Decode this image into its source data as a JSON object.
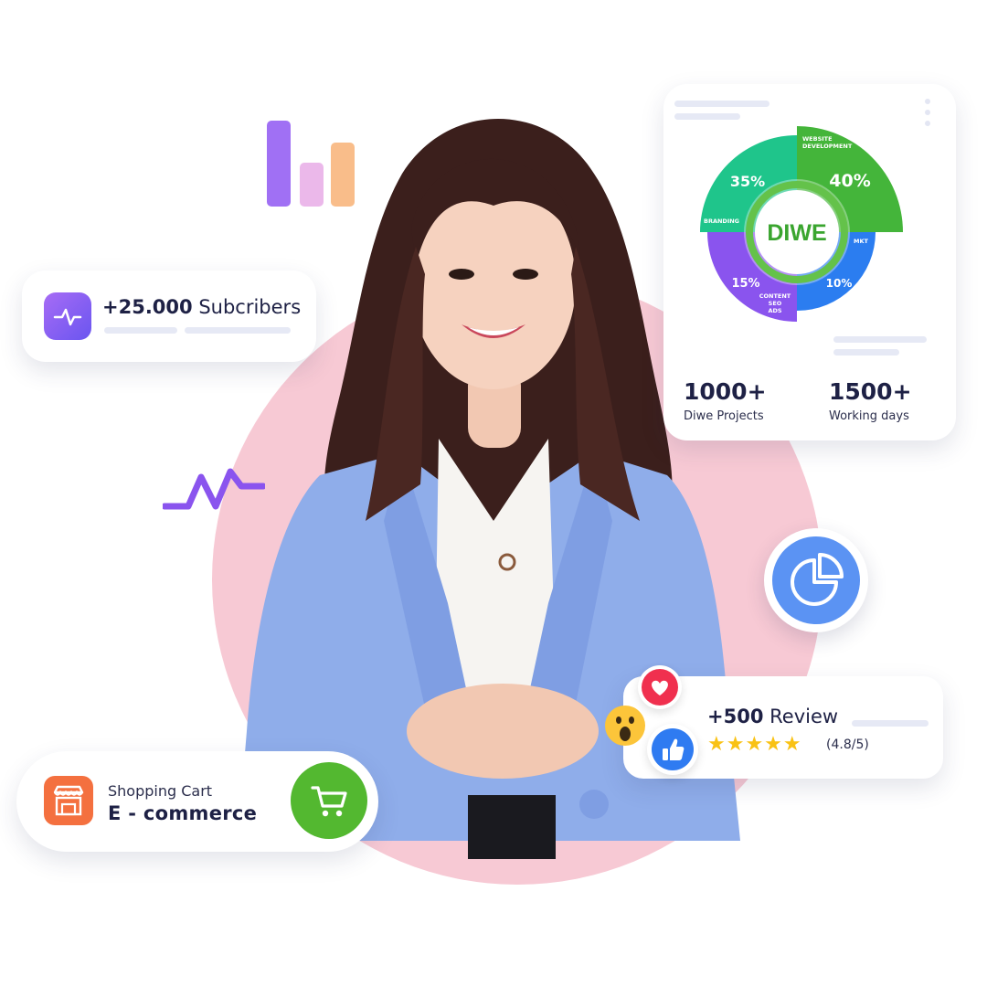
{
  "subscribers": {
    "count": "+25.000",
    "label": "Subcribers",
    "icon": "activity-icon"
  },
  "stats": {
    "logo": "DIWE",
    "segments": [
      {
        "label": "WEBSITE DEVELOPMENT",
        "percent": "40%",
        "color": "#44b53a"
      },
      {
        "label": "MKT",
        "percent": "10%",
        "color": "#2b7df0"
      },
      {
        "label": "CONTENT SEO ADS",
        "percent": "15%",
        "color": "#8a54ee"
      },
      {
        "label": "BRANDING",
        "percent": "35%",
        "color": "#1fc58b"
      }
    ],
    "projects": {
      "value": "1000+",
      "label": "Diwe Projects"
    },
    "days": {
      "value": "1500+",
      "label": "Working days"
    }
  },
  "review": {
    "count": "+500",
    "label": "Review",
    "stars": "★★★★★",
    "rating": "(4.8/5)",
    "reactions": [
      "heart-icon",
      "wow-emoji-icon",
      "thumbs-up-icon"
    ]
  },
  "cart": {
    "label": "Shopping Cart",
    "title": "E - commerce",
    "icons": [
      "storefront-icon",
      "shopping-cart-icon"
    ]
  },
  "colors": {
    "accent_purple": "#8a54ee",
    "pink_bg": "#f7c9d4",
    "blazer_blue": "#8fadea",
    "star_yellow": "#f9c215",
    "cart_green": "#53b830",
    "shop_orange": "#f4703f"
  }
}
